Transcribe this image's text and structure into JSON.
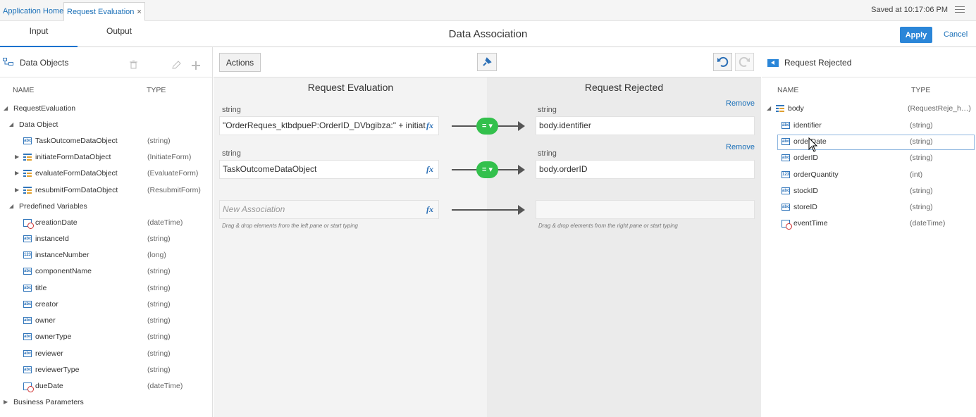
{
  "topbar": {
    "tabs": [
      "Application Home",
      "Request Evaluation"
    ],
    "close_glyph": "×",
    "saved": "Saved at 10:17:06 PM"
  },
  "header": {
    "tab_input": "Input",
    "tab_output": "Output",
    "title": "Data Association",
    "apply": "Apply",
    "cancel": "Cancel"
  },
  "left": {
    "title": "Data Objects",
    "col_name": "NAME",
    "col_type": "TYPE",
    "rows": [
      {
        "label": "RequestEvaluation",
        "type": ""
      },
      {
        "label": "Data Object",
        "type": ""
      },
      {
        "label": "TaskOutcomeDataObject",
        "type": "(string)"
      },
      {
        "label": "initiateFormDataObject",
        "type": "(InitiateForm)"
      },
      {
        "label": "evaluateFormDataObject",
        "type": "(EvaluateForm)"
      },
      {
        "label": "resubmitFormDataObject",
        "type": "(ResubmitForm)"
      },
      {
        "label": "Predefined Variables",
        "type": ""
      },
      {
        "label": "creationDate",
        "type": "(dateTime)"
      },
      {
        "label": "instanceId",
        "type": "(string)"
      },
      {
        "label": "instanceNumber",
        "type": "(long)"
      },
      {
        "label": "componentName",
        "type": "(string)"
      },
      {
        "label": "title",
        "type": "(string)"
      },
      {
        "label": "creator",
        "type": "(string)"
      },
      {
        "label": "owner",
        "type": "(string)"
      },
      {
        "label": "ownerType",
        "type": "(string)"
      },
      {
        "label": "reviewer",
        "type": "(string)"
      },
      {
        "label": "reviewerType",
        "type": "(string)"
      },
      {
        "label": "dueDate",
        "type": "(dateTime)"
      },
      {
        "label": "Business Parameters",
        "type": ""
      }
    ]
  },
  "middle": {
    "actions": "Actions",
    "left_title": "Request Evaluation",
    "right_title": "Request Rejected",
    "string_label": "string",
    "remove": "Remove",
    "assoc1_source": "\"OrderReques_ktbdpueP:OrderID_DVbgibza:\" + initiat",
    "assoc1_target": "body.identifier",
    "assoc2_source": "TaskOutcomeDataObject",
    "assoc2_target": "body.orderID",
    "new_placeholder": "New Association",
    "fx": "fx",
    "eq": "=",
    "hint_left": "Drag & drop elements from the left pane or start typing",
    "hint_right": "Drag & drop elements from the right pane or start typing"
  },
  "right": {
    "title": "Request Rejected",
    "col_name": "NAME",
    "col_type": "TYPE",
    "rows": [
      {
        "label": "body",
        "type": "(RequestReje_h…)"
      },
      {
        "label": "identifier",
        "type": "(string)"
      },
      {
        "label": "orderDate",
        "type": "(string)"
      },
      {
        "label": "orderID",
        "type": "(string)"
      },
      {
        "label": "orderQuantity",
        "type": "(int)"
      },
      {
        "label": "stockID",
        "type": "(string)"
      },
      {
        "label": "storeID",
        "type": "(string)"
      },
      {
        "label": "eventTime",
        "type": "(dateTime)"
      }
    ]
  },
  "colors": {
    "accent": "#2b86d8",
    "link": "#1b70b8",
    "eq_badge": "#33c04c"
  }
}
